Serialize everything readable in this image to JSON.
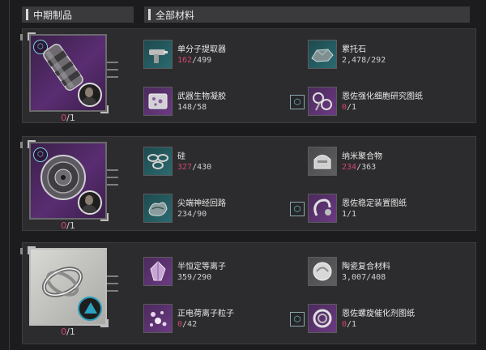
{
  "headers": {
    "left": "中期制品",
    "right": "全部材料"
  },
  "colors": {
    "shortage": "#d2486c",
    "accent": "#7ad0e0",
    "panel": "#2c2c2e"
  },
  "recipes": [
    {
      "product": {
        "icon": "capsule-canister-icon",
        "owned": "0",
        "required": "/1",
        "rarity": "purple"
      },
      "materials": [
        {
          "name": "单分子提取器",
          "have": "162",
          "need": "/499",
          "short": true,
          "icon": "extractor-gun-icon"
        },
        {
          "name": "累托石",
          "have": "2,478",
          "need": "/292",
          "short": false,
          "icon": "rectorite-ore-icon"
        },
        {
          "name": "武器生物凝胶",
          "have": "148",
          "need": "/58",
          "short": false,
          "icon": "bio-gel-pack-icon"
        },
        {
          "name": "恩佐强化细胞研究图纸",
          "have": "0",
          "need": "/1",
          "short": true,
          "icon": "cell-blueprint-icon"
        }
      ]
    },
    {
      "product": {
        "icon": "neural-disc-icon",
        "owned": "0",
        "required": "/1",
        "rarity": "purple"
      },
      "materials": [
        {
          "name": "硅",
          "have": "327",
          "need": "/430",
          "short": true,
          "icon": "silicon-rings-icon"
        },
        {
          "name": "纳米聚合物",
          "have": "234",
          "need": "/363",
          "short": true,
          "icon": "nano-polymer-icon"
        },
        {
          "name": "尖端神经回路",
          "have": "234",
          "need": "/90",
          "short": false,
          "icon": "neural-circuit-icon"
        },
        {
          "name": "恩佐稳定装置图纸",
          "have": "1",
          "need": "/1",
          "short": false,
          "icon": "stabilizer-blueprint-icon"
        }
      ]
    },
    {
      "product": {
        "icon": "gyro-rings-icon",
        "owned": "0",
        "required": "/1",
        "rarity": "white"
      },
      "materials": [
        {
          "name": "半恒定等离子",
          "have": "359",
          "need": "/290",
          "short": false,
          "icon": "plasma-crystal-icon"
        },
        {
          "name": "陶瓷复合材料",
          "have": "3,007",
          "need": "/408",
          "short": false,
          "icon": "ceramic-composite-icon"
        },
        {
          "name": "正电荷离子粒子",
          "have": "0",
          "need": "/42",
          "short": true,
          "icon": "ion-particle-icon"
        },
        {
          "name": "恩佐螺旋催化剂图纸",
          "have": "0",
          "need": "/1",
          "short": true,
          "icon": "spiral-catalyst-blueprint-icon"
        }
      ]
    }
  ]
}
